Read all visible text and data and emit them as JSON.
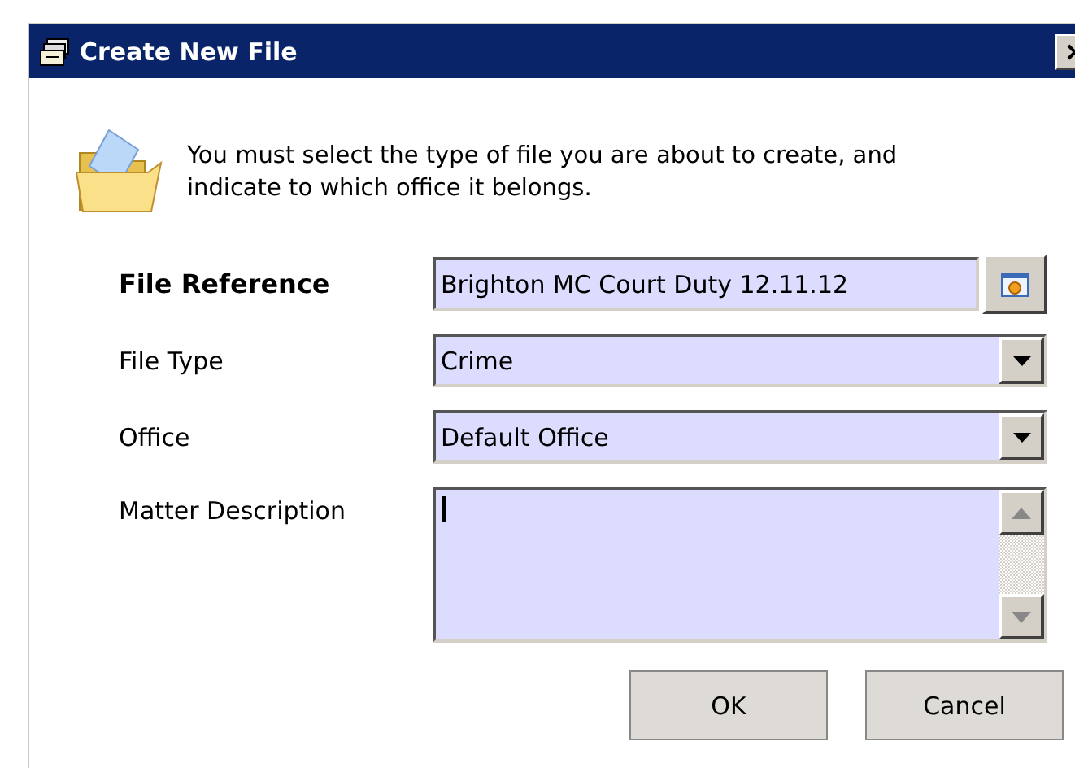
{
  "window": {
    "title": "Create New File"
  },
  "instruction": "You must select the type of file you are about to create, and indicate to which office it belongs.",
  "fields": [
    {
      "label": "File Reference",
      "emphasized": true,
      "kind": "lookup",
      "value": "Brighton MC Court Duty 12.11.12"
    },
    {
      "label": "File Type",
      "emphasized": false,
      "kind": "dropdown",
      "value": "Crime"
    },
    {
      "label": "Office",
      "emphasized": false,
      "kind": "dropdown",
      "value": "Default Office"
    },
    {
      "label": "Matter Description",
      "emphasized": false,
      "kind": "memo"
    }
  ],
  "buttons": [
    "OK",
    "Cancel"
  ]
}
